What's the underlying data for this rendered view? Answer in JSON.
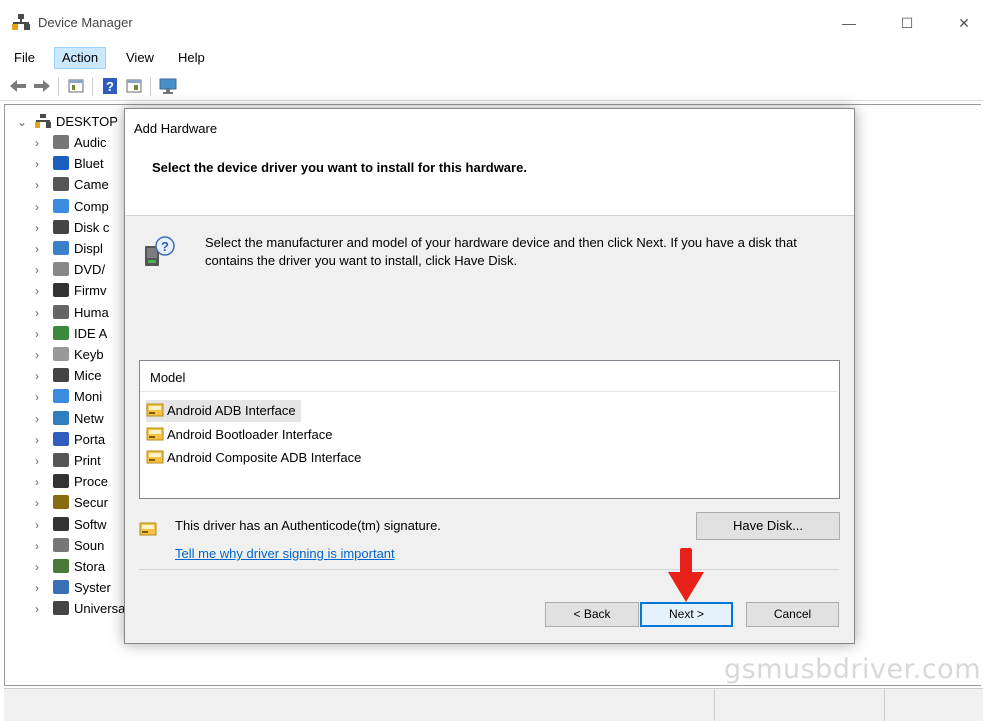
{
  "window": {
    "title": "Device Manager",
    "controls": {
      "minimize": "—",
      "maximize": "☐",
      "close": "✕"
    }
  },
  "menu": {
    "file": "File",
    "action": "Action",
    "view": "View",
    "help": "Help"
  },
  "toolbar": [
    "back-icon",
    "forward-icon",
    "properties-icon",
    "help-icon",
    "update-driver-icon",
    "scan-hardware-icon"
  ],
  "tree": {
    "root": "DESKTOP",
    "items": [
      {
        "label": "Audic",
        "icon": "audio-icon"
      },
      {
        "label": "Bluet",
        "icon": "bluetooth-icon"
      },
      {
        "label": "Came",
        "icon": "camera-icon"
      },
      {
        "label": "Comp",
        "icon": "computer-icon"
      },
      {
        "label": "Disk c",
        "icon": "disk-icon"
      },
      {
        "label": "Displ",
        "icon": "display-icon"
      },
      {
        "label": "DVD/",
        "icon": "dvd-icon"
      },
      {
        "label": "Firmv",
        "icon": "firmware-icon"
      },
      {
        "label": "Huma",
        "icon": "human-interface-icon"
      },
      {
        "label": "IDE A",
        "icon": "ide-icon"
      },
      {
        "label": "Keyb",
        "icon": "keyboard-icon"
      },
      {
        "label": "Mice",
        "icon": "mouse-icon"
      },
      {
        "label": "Moni",
        "icon": "monitor-icon"
      },
      {
        "label": "Netw",
        "icon": "network-icon"
      },
      {
        "label": "Porta",
        "icon": "portable-icon"
      },
      {
        "label": "Print",
        "icon": "printer-icon"
      },
      {
        "label": "Proce",
        "icon": "processor-icon"
      },
      {
        "label": "Secur",
        "icon": "security-icon"
      },
      {
        "label": "Softw",
        "icon": "software-icon"
      },
      {
        "label": "Soun",
        "icon": "sound-icon"
      },
      {
        "label": "Stora",
        "icon": "storage-icon"
      },
      {
        "label": "Syster",
        "icon": "system-icon"
      },
      {
        "label": "Universal Serial Bus controllers",
        "icon": "usb-icon"
      }
    ]
  },
  "dialog": {
    "title": "Add Hardware",
    "heading": "Select the device driver you want to install for this hardware.",
    "description": "Select the manufacturer and model of your hardware device and then click Next. If you have a disk that contains the driver you want to install, click Have Disk.",
    "model_header": "Model",
    "models": [
      {
        "label": "Android ADB Interface",
        "selected": true
      },
      {
        "label": "Android Bootloader Interface",
        "selected": false
      },
      {
        "label": "Android Composite ADB Interface",
        "selected": false
      }
    ],
    "signature_text": "This driver has an Authenticode(tm) signature.",
    "signing_link": "Tell me why driver signing is important",
    "have_disk": "Have Disk...",
    "back": "< Back",
    "next": "Next >",
    "cancel": "Cancel"
  },
  "watermark": "gsmusbdriver.com",
  "colors": {
    "accent": "#0078d7",
    "link": "#0066cc",
    "arrow": "#e8221a",
    "selection": "#cce8ff"
  }
}
